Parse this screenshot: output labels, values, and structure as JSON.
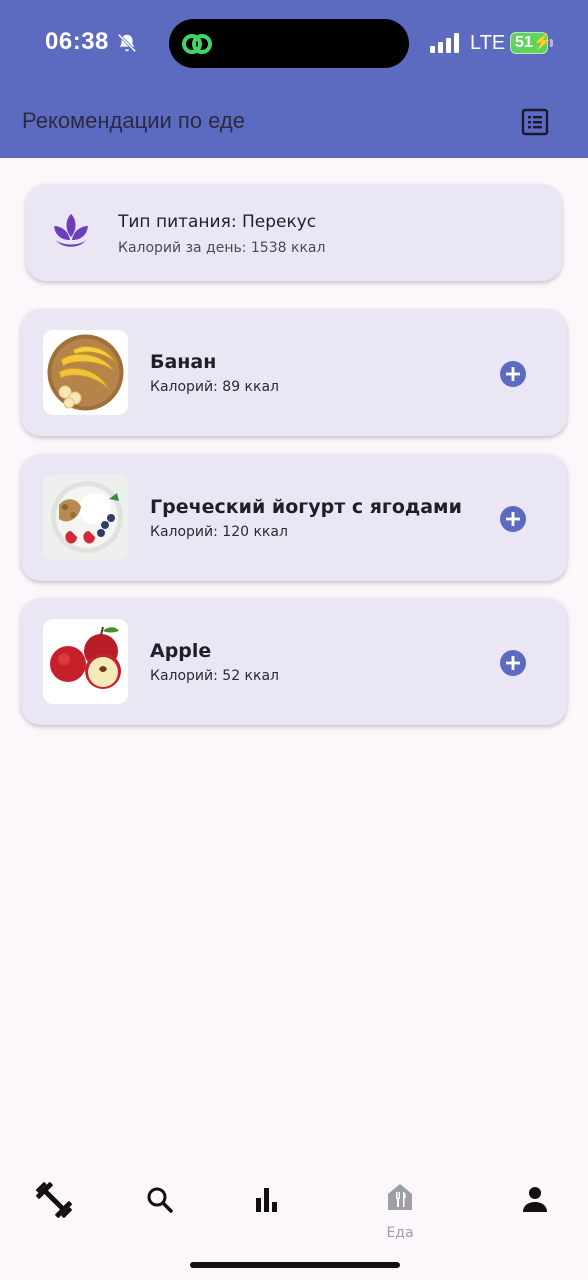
{
  "status_bar": {
    "time": "06:38",
    "network": "LTE",
    "battery": "51"
  },
  "header": {
    "title": "Рекомендации по еде"
  },
  "summary": {
    "meal_type": "Тип питания: Перекус",
    "daily_calories": "Калорий за день: 1538 ккал"
  },
  "foods": [
    {
      "name": "Банан",
      "calories": "Калорий: 89 ккал"
    },
    {
      "name": "Греческий йогурт с ягодами",
      "calories": "Калорий: 120 ккал"
    },
    {
      "name": "Apple",
      "calories": "Калорий: 52 ккал"
    }
  ],
  "nav": {
    "food_label": "Еда"
  },
  "colors": {
    "primary": "#5c6bc0",
    "card": "#ebe6f3",
    "background": "#fdf7fc",
    "accent_purple": "#6a3fbf"
  }
}
